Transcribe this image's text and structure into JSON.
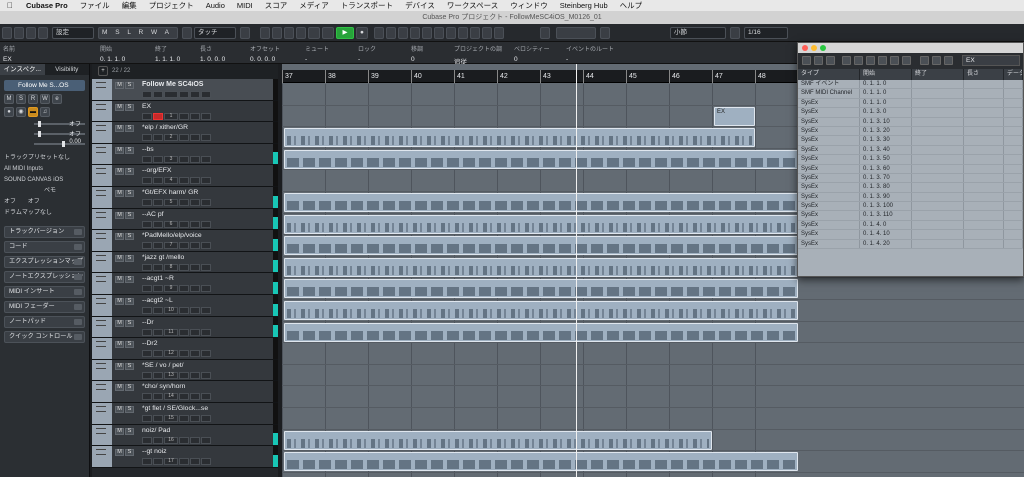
{
  "menubar": {
    "app": "Cubase Pro",
    "items": [
      "ファイル",
      "編集",
      "プロジェクト",
      "Audio",
      "MIDI",
      "スコア",
      "メディア",
      "トランスポート",
      "デバイス",
      "ワークスペース",
      "ウィンドウ",
      "Steinberg Hub",
      "ヘルプ"
    ]
  },
  "window_title": "Cubase Pro プロジェクト - FollowMeSC4iOS_M0126_01",
  "toolbar": {
    "preset": "設定",
    "automation": "タッチ",
    "grid": "小節",
    "quantize": "1/16",
    "mode_letters": "M S L R W A"
  },
  "infoline": {
    "columns": [
      {
        "label": "名前",
        "value": "EX"
      },
      {
        "label": "開始",
        "value": "0. 1. 1. 0"
      },
      {
        "label": "終了",
        "value": "1. 1. 1. 0"
      },
      {
        "label": "長さ",
        "value": "1. 0. 0. 0"
      },
      {
        "label": "オフセット",
        "value": "0. 0. 0. 0"
      },
      {
        "label": "ミュート",
        "value": "-"
      },
      {
        "label": "ロック",
        "value": "-"
      },
      {
        "label": "移調",
        "value": "0"
      },
      {
        "label": "プロジェクトの調",
        "value": "追従"
      },
      {
        "label": "ベロシティー",
        "value": "0"
      },
      {
        "label": "イベントのルート",
        "value": "-"
      }
    ]
  },
  "inspector": {
    "tabs": [
      "インスペク...",
      "Visibility"
    ],
    "track_name": "Follow Me S...OS",
    "volume_label": "オフ",
    "pan_label": "オフ",
    "pan_value": "0.00",
    "routing": [
      "トラックプリセットなし",
      "All MIDI Inputs",
      "SOUND CANVAS iOS",
      "ペモ",
      "オフ",
      "オフ",
      "ドラムマップなし"
    ],
    "panels": [
      "トラックバージョン",
      "コード",
      "エクスプレッションマップ",
      "ノートエクスプレッション",
      "MIDI インサート",
      "MIDI フェーダー",
      "ノートパッド",
      "クイック コントロール"
    ]
  },
  "tracklist": {
    "count": "22 / 22",
    "tracks": [
      {
        "name": "Follow Me SC4iOS",
        "num": "",
        "meter": false
      },
      {
        "name": "EX",
        "num": "1",
        "meter": false
      },
      {
        "name": "*elp / xither/GR",
        "num": "2",
        "meter": false
      },
      {
        "name": "--bs",
        "num": "3",
        "meter": true
      },
      {
        "name": "--org/EFX",
        "num": "4",
        "meter": false
      },
      {
        "name": "*Gt/EFX  harm/ GR",
        "num": "5",
        "meter": true
      },
      {
        "name": "--AC pf",
        "num": "6",
        "meter": true
      },
      {
        "name": "*PadMello/elp/voice",
        "num": "7",
        "meter": true
      },
      {
        "name": "*jazz gt /mello",
        "num": "8",
        "meter": true
      },
      {
        "name": "--acgt1 ~R",
        "num": "9",
        "meter": true
      },
      {
        "name": "--acgt2 ~L",
        "num": "10",
        "meter": true
      },
      {
        "name": "--Dr",
        "num": "11",
        "meter": true
      },
      {
        "name": "--Dr2",
        "num": "12",
        "meter": false
      },
      {
        "name": "*SE / vo / pet/",
        "num": "13",
        "meter": false
      },
      {
        "name": "*cho/ syn/horn",
        "num": "14",
        "meter": false
      },
      {
        "name": "*gt flet / SE/Glock...se",
        "num": "15",
        "meter": false
      },
      {
        "name": "noiz/ Pad",
        "num": "16",
        "meter": true
      },
      {
        "name": "--gt noiz",
        "num": "17",
        "meter": true
      }
    ]
  },
  "ruler": {
    "bars": [
      "37",
      "38",
      "39",
      "40",
      "41",
      "42",
      "43",
      "44",
      "45",
      "46",
      "47",
      "48"
    ]
  },
  "parts": {
    "ex_label": "EX"
  },
  "list_editor": {
    "filter": "EX",
    "columns": [
      "タイプ",
      "開始",
      "終了",
      "長さ",
      "データ"
    ],
    "rows": [
      {
        "type": "SMF イベント",
        "start": "0.  1.  1.   0"
      },
      {
        "type": "SMF  MIDI Channel",
        "start": "0.  1.  1.   0"
      },
      {
        "type": "SysEx",
        "start": "0.  1.  1.   0"
      },
      {
        "type": "SysEx",
        "start": "0.  1.  3.   0"
      },
      {
        "type": "SysEx",
        "start": "0.  1.  3.  10"
      },
      {
        "type": "SysEx",
        "start": "0.  1.  3.  20"
      },
      {
        "type": "SysEx",
        "start": "0.  1.  3.  30"
      },
      {
        "type": "SysEx",
        "start": "0.  1.  3.  40"
      },
      {
        "type": "SysEx",
        "start": "0.  1.  3.  50"
      },
      {
        "type": "SysEx",
        "start": "0.  1.  3.  60"
      },
      {
        "type": "SysEx",
        "start": "0.  1.  3.  70"
      },
      {
        "type": "SysEx",
        "start": "0.  1.  3.  80"
      },
      {
        "type": "SysEx",
        "start": "0.  1.  3.  90"
      },
      {
        "type": "SysEx",
        "start": "0.  1.  3. 100"
      },
      {
        "type": "SysEx",
        "start": "0.  1.  3. 110"
      },
      {
        "type": "SysEx",
        "start": "0.  1.  4.   0"
      },
      {
        "type": "SysEx",
        "start": "0.  1.  4.  10"
      },
      {
        "type": "SysEx",
        "start": "0.  1.  4.  20"
      }
    ]
  },
  "colors": {
    "accent": "#27a33a",
    "part": "#9fb0c1",
    "meter": "#18c7b6",
    "record": "#c62a2a"
  }
}
